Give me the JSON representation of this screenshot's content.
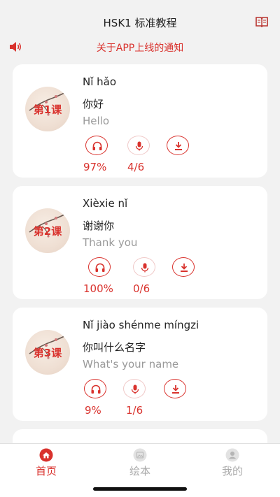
{
  "header": {
    "title": "HSK1 标准教程",
    "book_icon": "book-icon"
  },
  "notice": {
    "icon": "speaker-icon",
    "text": "关于APP上线的通知"
  },
  "lessons": [
    {
      "badge": "第1课",
      "pinyin": "Nǐ hǎo",
      "hanzi": "你好",
      "english": "Hello",
      "listen_progress": "97%",
      "record_progress": "4/6"
    },
    {
      "badge": "第2课",
      "pinyin": "Xièxie nǐ",
      "hanzi": "谢谢你",
      "english": "Thank you",
      "listen_progress": "100%",
      "record_progress": "0/6"
    },
    {
      "badge": "第3课",
      "pinyin": "Nǐ jiào shénme míngzi",
      "hanzi": "你叫什么名字",
      "english": "What's your name",
      "listen_progress": "9%",
      "record_progress": "1/6"
    }
  ],
  "tabs": [
    {
      "label": "首页",
      "icon": "home-icon",
      "active": true
    },
    {
      "label": "绘本",
      "icon": "picture-book-icon",
      "active": false
    },
    {
      "label": "我的",
      "icon": "profile-icon",
      "active": false
    }
  ],
  "colors": {
    "accent": "#d9322d",
    "background": "#f2f2f2",
    "muted": "#9a9a9a"
  }
}
